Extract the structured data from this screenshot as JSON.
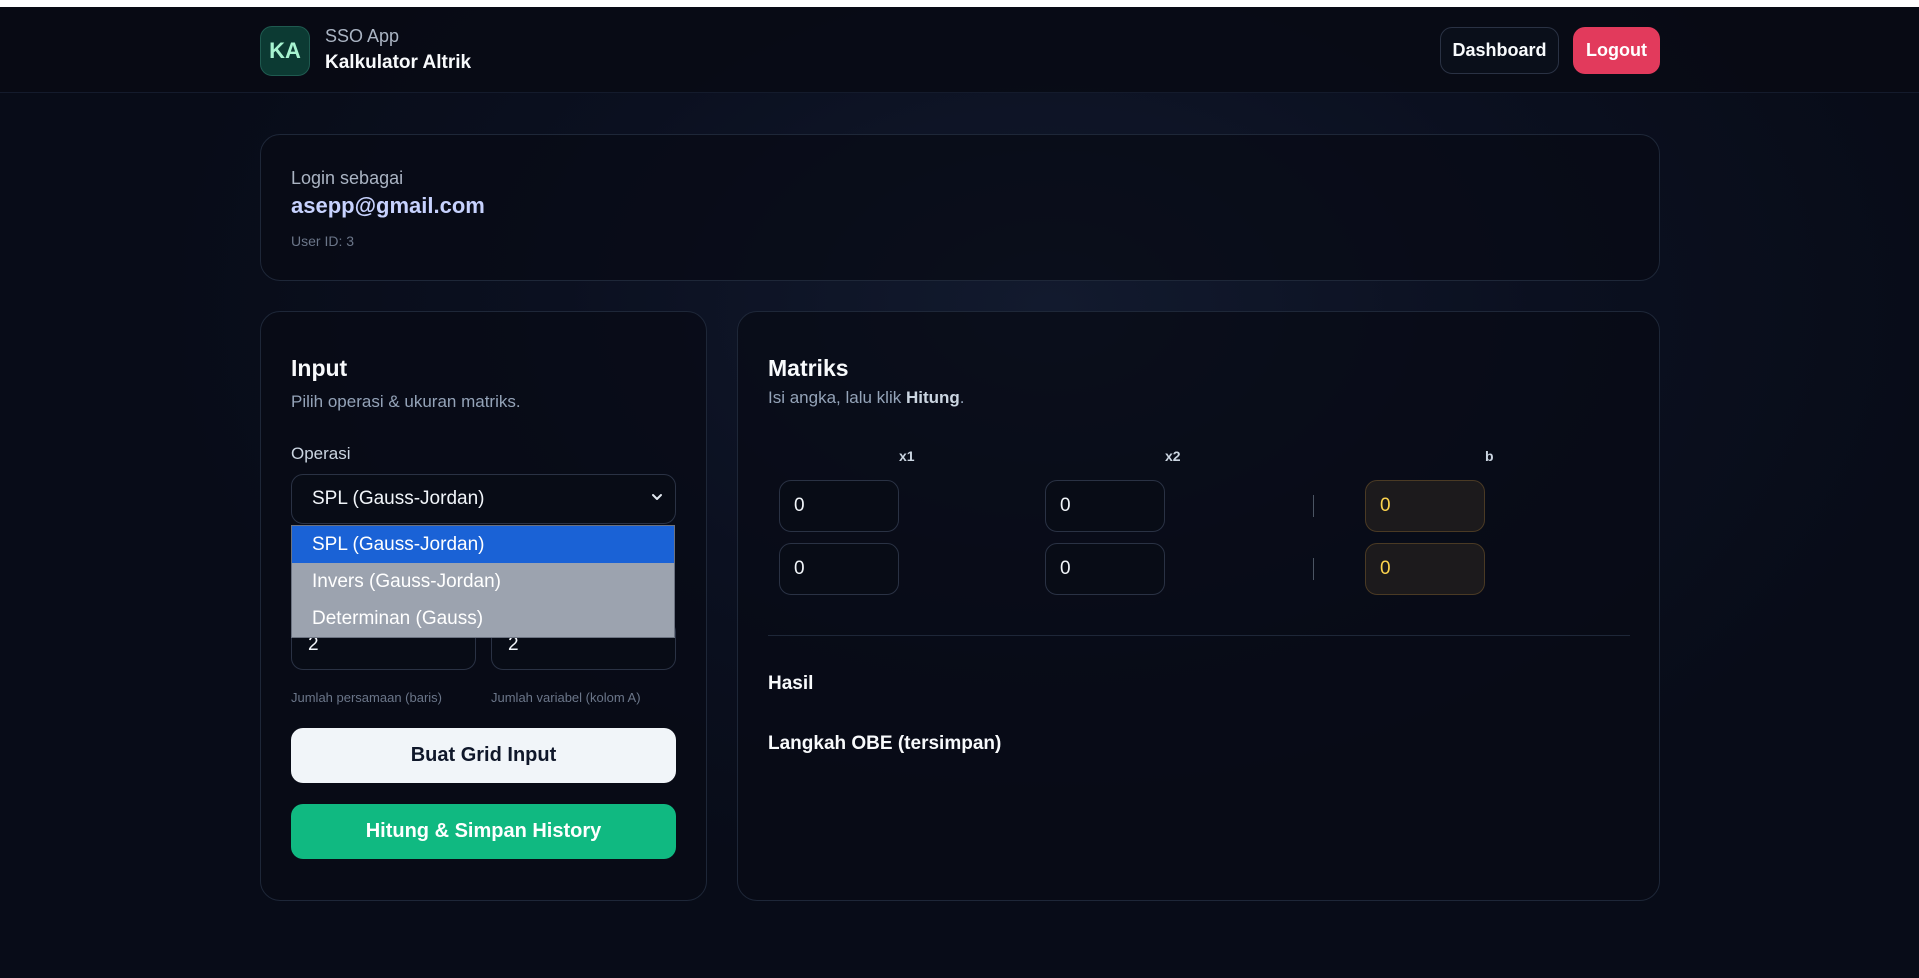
{
  "header": {
    "logo_initials": "KA",
    "app_subtitle": "SSO App",
    "app_title": "Kalkulator Altrik",
    "dashboard_label": "Dashboard",
    "logout_label": "Logout"
  },
  "user": {
    "login_label": "Login sebagai",
    "email": "asepp@gmail.com",
    "user_id": "User ID: 3"
  },
  "input_panel": {
    "title": "Input",
    "subtitle": "Pilih operasi & ukuran matriks.",
    "operation_label": "Operasi",
    "operation_selected": "SPL (Gauss-Jordan)",
    "operation_options": [
      "SPL (Gauss-Jordan)",
      "Invers (Gauss-Jordan)",
      "Determinan (Gauss)"
    ],
    "rows_value": "2",
    "cols_value": "2",
    "rows_hint": "Jumlah persamaan (baris)",
    "cols_hint": "Jumlah variabel (kolom A)",
    "build_grid_label": "Buat Grid Input",
    "calculate_label": "Hitung & Simpan History"
  },
  "matrix_panel": {
    "title": "Matriks",
    "subtitle_prefix": "Isi angka, lalu klik ",
    "subtitle_bold": "Hitung",
    "subtitle_suffix": ".",
    "columns": [
      "x1",
      "x2",
      "b"
    ],
    "rows": [
      [
        "0",
        "0",
        "0"
      ],
      [
        "0",
        "0",
        "0"
      ]
    ],
    "result_title": "Hasil",
    "steps_title": "Langkah OBE (tersimpan)"
  },
  "colors": {
    "primary_button": "#10b981",
    "logout_button": "#e23a5c",
    "selected_option": "#1a62d6",
    "b_column_text": "#fcd34d"
  }
}
